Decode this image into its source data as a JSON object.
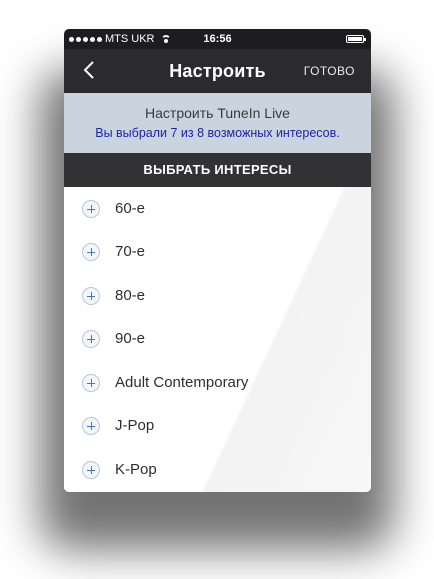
{
  "status": {
    "carrier": "MTS UKR",
    "time": "16:56"
  },
  "nav": {
    "title": "Настроить",
    "done_label": "ГОТОВО"
  },
  "info": {
    "title": "Настроить TuneIn Live",
    "subtitle": "Вы выбрали 7 из 8 возможных интересов."
  },
  "section": {
    "header": "ВЫБРАТЬ ИНТЕРЕСЫ"
  },
  "interests": [
    {
      "label": "60-е"
    },
    {
      "label": "70-е"
    },
    {
      "label": "80-е"
    },
    {
      "label": "90-е"
    },
    {
      "label": "Adult Contemporary"
    },
    {
      "label": "J-Pop"
    },
    {
      "label": "K-Pop"
    }
  ],
  "colors": {
    "navbar": "#2b2b2d",
    "info_background": "#c9d4de",
    "subtitle_text": "#1f25a8",
    "section_header": "#323234"
  }
}
